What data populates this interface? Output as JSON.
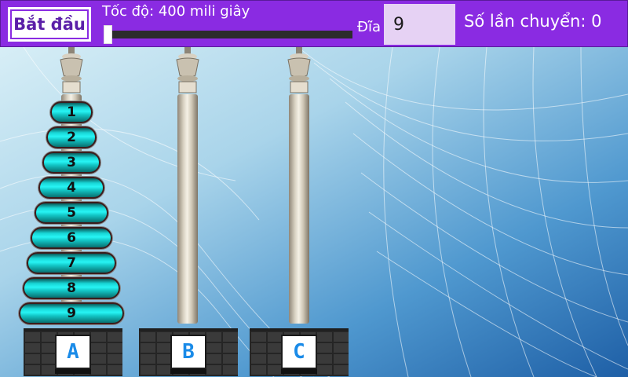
{
  "toolbar": {
    "start_label": "Bắt đầu",
    "speed_label": "Tốc độ: 400 mili giây",
    "speed_level": 0.0,
    "disk_label": "Đĩa",
    "disk_count": "9",
    "moves_label": "Số lần chuyển: 0"
  },
  "pegs": [
    {
      "label": "A",
      "disks": [
        "1",
        "2",
        "3",
        "4",
        "5",
        "6",
        "7",
        "8",
        "9"
      ]
    },
    {
      "label": "B",
      "disks": []
    },
    {
      "label": "C",
      "disks": []
    }
  ],
  "colors": {
    "toolbar": "#8a2be2",
    "disk": "#27f4f4",
    "peg_letter": "#1a8be8"
  }
}
